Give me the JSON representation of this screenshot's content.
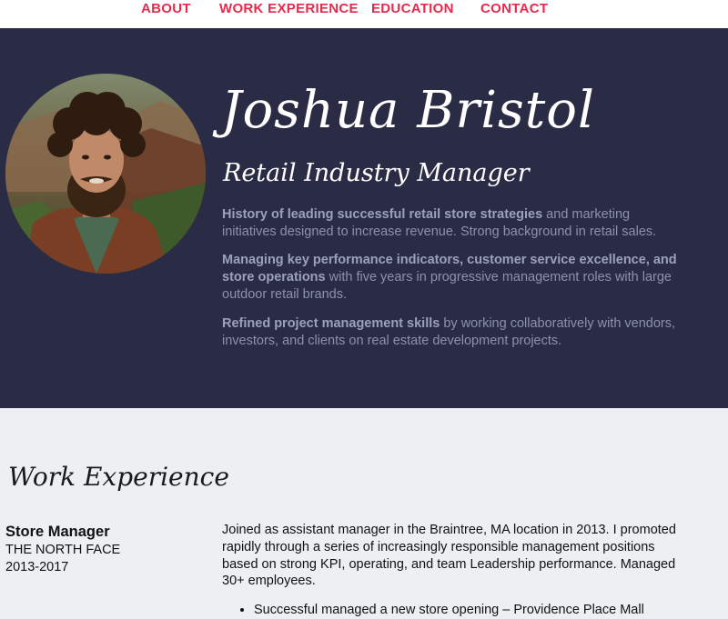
{
  "nav": {
    "items": [
      {
        "label": "ABOUT"
      },
      {
        "label": "WORK EXPERIENCE"
      },
      {
        "label": "EDUCATION"
      },
      {
        "label": "CONTACT"
      }
    ]
  },
  "hero": {
    "name": "Joshua Bristol",
    "title": "Retail Industry Manager",
    "paragraphs": [
      {
        "bold": "History of leading successful retail store strategies",
        "text": " and marketing initiatives designed to increase revenue. Strong background in retail sales."
      },
      {
        "bold": "Managing key performance indicators, customer service excellence, and store operations",
        "text": " with five years in progressive management roles with large outdoor retail brands."
      },
      {
        "bold": "Refined project management skills",
        "text": " by working collaboratively with vendors, investors, and clients on real estate development projects."
      }
    ]
  },
  "experience": {
    "heading": "Work Experience",
    "jobs": [
      {
        "title": "Store Manager",
        "company": "THE NORTH FACE",
        "dates": "2013-2017",
        "description": "Joined as assistant manager in the Braintree, MA location in 2013. I promoted rapidly through a series of increasingly responsible management positions based on strong KPI, operating, and team Leadership performance. Managed 30+ employees.",
        "bullets": [
          "Successful managed a new store opening – Providence Place Mall"
        ]
      }
    ]
  },
  "colors": {
    "accent": "#e8294c",
    "hero_bg": "#2a2c45",
    "page_bg": "#ecf0f2"
  }
}
